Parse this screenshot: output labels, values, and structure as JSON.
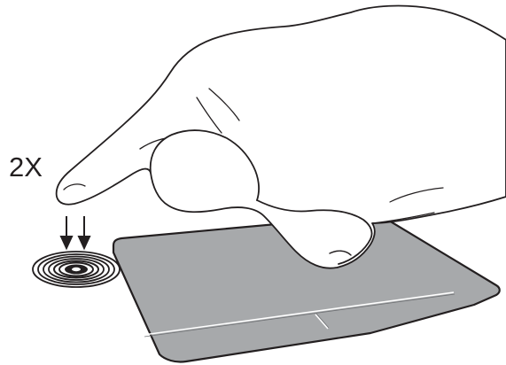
{
  "tap_count_label": "2X",
  "icons": {
    "hand": "hand-icon",
    "touchpad": "touchpad-icon",
    "tap_arrows": "double-down-arrow-icon",
    "tap_ripple": "tap-ripple-icon"
  },
  "colors": {
    "outline": "#231f20",
    "touchpad_fill": "#a7a9ab",
    "touchpad_buttons": "#9c9ea1",
    "hand_fill": "#ffffff",
    "background": "#ffffff"
  }
}
